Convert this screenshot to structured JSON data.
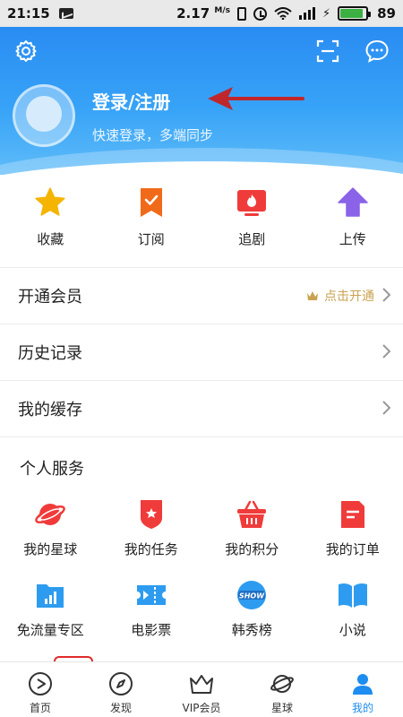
{
  "status_bar": {
    "time": "21:15",
    "speed_value": "2.17",
    "speed_unit": "M/s",
    "battery": "89",
    "battery_fill": 0.89,
    "icons": [
      "message-icon",
      "vibrate-icon",
      "alarm-icon",
      "wifi-icon",
      "signal-icon",
      "charging-icon",
      "battery-icon"
    ]
  },
  "header": {
    "login_title": "登录/注册",
    "login_subtitle": "快速登录，多端同步",
    "icons": [
      "gear-icon",
      "scan-icon",
      "chat-icon"
    ],
    "colors": {
      "gradient_top": "#2a8cf2",
      "gradient_bottom": "#5fbcf8",
      "annotation_arrow": "#c0272d"
    }
  },
  "quick_actions": [
    {
      "label": "收藏",
      "icon": "star-icon",
      "color": "#f5b400"
    },
    {
      "label": "订阅",
      "icon": "subscribe-bookmark-icon",
      "color": "#f06a1a"
    },
    {
      "label": "追剧",
      "icon": "tv-fire-icon",
      "color": "#f03b3b"
    },
    {
      "label": "上传",
      "icon": "upload-arrow-icon",
      "color": "#8a63e8"
    }
  ],
  "menu_rows": {
    "vip": {
      "label": "开通会员",
      "action": "点击开通"
    },
    "history": {
      "label": "历史记录"
    },
    "cache": {
      "label": "我的缓存"
    }
  },
  "services": {
    "title": "个人服务",
    "items": [
      {
        "label": "我的星球",
        "icon": "planet-icon"
      },
      {
        "label": "我的任务",
        "icon": "task-badge-icon"
      },
      {
        "label": "我的积分",
        "icon": "basket-icon"
      },
      {
        "label": "我的订单",
        "icon": "order-doc-icon"
      },
      {
        "label": "免流量专区",
        "icon": "data-chart-icon"
      },
      {
        "label": "电影票",
        "icon": "ticket-icon"
      },
      {
        "label": "韩秀榜",
        "icon": "show-badge-icon"
      },
      {
        "label": "小说",
        "icon": "book-icon"
      }
    ],
    "show_badge_text": "SHOW"
  },
  "bottom_nav": [
    {
      "label": "首页",
      "icon": "home-play-icon"
    },
    {
      "label": "发现",
      "icon": "compass-icon"
    },
    {
      "label": "VIP会员",
      "icon": "crown-icon"
    },
    {
      "label": "星球",
      "icon": "planet-icon"
    },
    {
      "label": "我的",
      "icon": "profile-icon",
      "active": true
    }
  ]
}
